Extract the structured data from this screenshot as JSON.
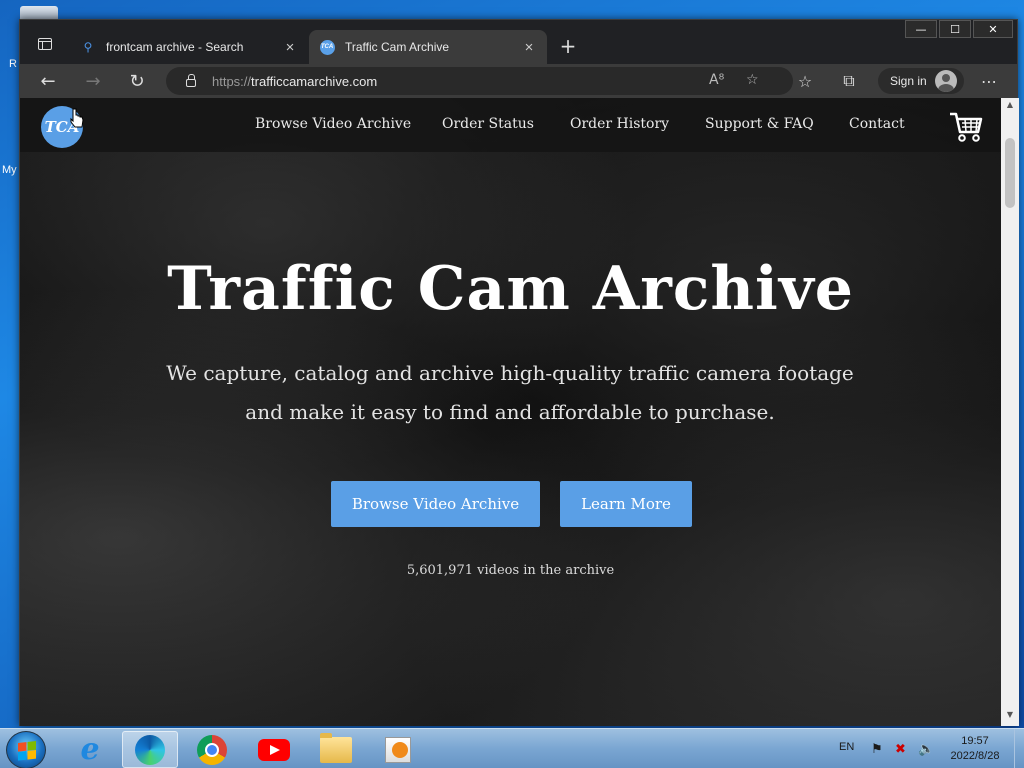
{
  "desktop": {
    "icon_labels": [
      "R",
      "My"
    ]
  },
  "browser": {
    "tabs": [
      {
        "title": "frontcam archive - Search",
        "favicon": "search-icon",
        "active": false
      },
      {
        "title": "Traffic Cam Archive",
        "favicon": "tca-favicon",
        "active": true
      }
    ],
    "address": {
      "protocol": "https://",
      "host": "trafficcamarchive.com"
    },
    "signin_label": "Sign in",
    "window_controls": {
      "minimize": "—",
      "maximize": "☐",
      "close": "✕"
    }
  },
  "site": {
    "logo_text": "TCA",
    "nav": [
      {
        "label": "Browse Video Archive"
      },
      {
        "label": "Order Status"
      },
      {
        "label": "Order History"
      },
      {
        "label": "Support & FAQ"
      },
      {
        "label": "Contact"
      }
    ],
    "hero": {
      "title": "Traffic Cam Archive",
      "subtitle": "We capture, catalog and archive high-quality traffic camera footage and make it easy to find and affordable to purchase.",
      "primary_button": "Browse Video Archive",
      "secondary_button": "Learn More",
      "count_text": "5,601,971 videos in the archive"
    },
    "accent_color": "#5a9fe6"
  },
  "taskbar": {
    "apps": [
      "internet-explorer",
      "edge",
      "chrome",
      "youtube",
      "file-explorer",
      "media-player"
    ],
    "language": "EN",
    "time": "19:57",
    "date": "2022/8/28"
  }
}
